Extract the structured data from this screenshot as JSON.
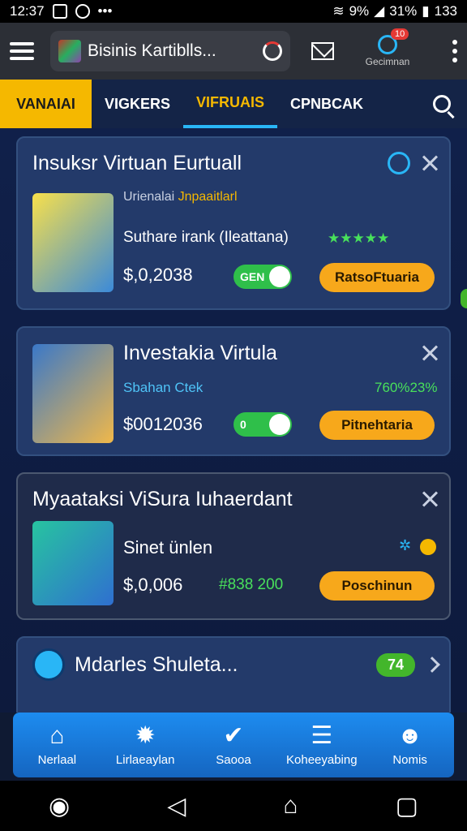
{
  "status_bar": {
    "time": "12:37",
    "battery": "31%",
    "signal_text": "9%",
    "extra": "133"
  },
  "top_bar": {
    "app_title": "Bisinis Kartiblls...",
    "notif_count": "10",
    "notif_label": "Gecimnan"
  },
  "tabs": [
    "VANAIAI",
    "VIGKERS",
    "VIFRUAIS",
    "CPNBCAK"
  ],
  "cards": [
    {
      "title": "Insuksr Virtuan Eurtuall",
      "subtitle_prefix": "Urienalai",
      "subtitle_highlight": "Jnpaaitlarl",
      "description": "Suthare irank (Ileattana)",
      "rating": "★★★★★",
      "price": "$,0,2038",
      "toggle_label": "GEN",
      "button": "RatsoFtuaria"
    },
    {
      "title": "Investakia Virtula",
      "subtitle": "Sbahan Ctek",
      "stat": "760%23%",
      "price": "$0012036",
      "toggle_label": "0",
      "button": "Pitnehtaria"
    },
    {
      "title": "Myaataksi ViSura Iuhaerdant",
      "description": "Sinet ünlen",
      "price": "$,0,006",
      "stat": "#838 200",
      "button": "Poschinun"
    },
    {
      "title": "Mdarles Shuleta...",
      "badge": "74"
    }
  ],
  "bottom_nav": [
    {
      "label": "Nerlaal",
      "glyph": "⌂"
    },
    {
      "label": "Lirlaeaylan",
      "glyph": "✹"
    },
    {
      "label": "Saooa",
      "glyph": "✔"
    },
    {
      "label": "Koheeyabing",
      "glyph": "☰"
    },
    {
      "label": "Nomis",
      "glyph": "☻"
    }
  ],
  "system_nav": {
    "back": "◁",
    "home": "⌂",
    "recents": "▢",
    "assistant": "◉"
  },
  "colors": {
    "accent": "#f5b800",
    "primary": "#1d8cf0",
    "success": "#2fbf4a",
    "button": "#f7a81b"
  }
}
